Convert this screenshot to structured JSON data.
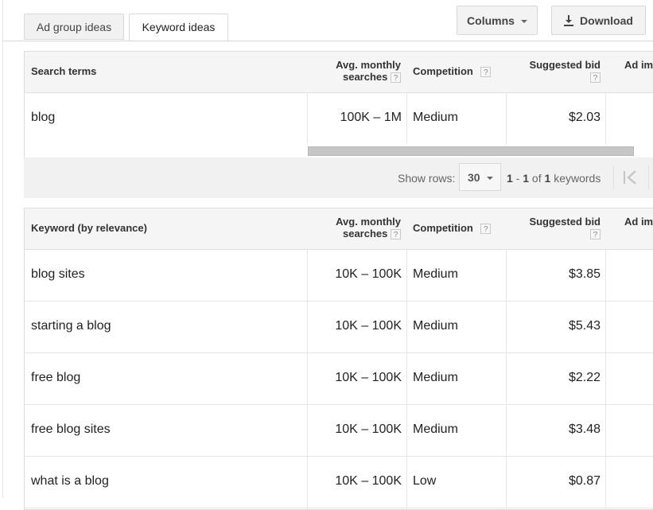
{
  "tabs": [
    {
      "label": "Ad group ideas"
    },
    {
      "label": "Keyword ideas"
    }
  ],
  "toolbar": {
    "columns_label": "Columns",
    "download_label": "Download"
  },
  "table1": {
    "headers": {
      "term": "Search terms",
      "avg_line1": "Avg. monthly",
      "avg_line2": "searches",
      "competition": "Competition",
      "bid": "Suggested bid",
      "adim": "Ad im"
    },
    "rows": [
      {
        "term": "blog",
        "avg": "100K – 1M",
        "competition": "Medium",
        "bid": "$2.03"
      }
    ]
  },
  "pager": {
    "show_rows_label": "Show rows:",
    "rows_value": "30",
    "range_start": "1",
    "range_dash": " - ",
    "range_end": "1",
    "of_text": " of ",
    "total": "1",
    "unit": " keywords"
  },
  "table2": {
    "headers": {
      "term": "Keyword (by relevance)",
      "avg_line1": "Avg. monthly",
      "avg_line2": "searches",
      "competition": "Competition",
      "bid": "Suggested bid",
      "adim": "Ad im"
    },
    "rows": [
      {
        "term": "blog sites",
        "avg": "10K – 100K",
        "competition": "Medium",
        "bid": "$3.85"
      },
      {
        "term": "starting a blog",
        "avg": "10K – 100K",
        "competition": "Medium",
        "bid": "$5.43"
      },
      {
        "term": "free blog",
        "avg": "10K – 100K",
        "competition": "Medium",
        "bid": "$2.22"
      },
      {
        "term": "free blog sites",
        "avg": "10K – 100K",
        "competition": "Medium",
        "bid": "$3.48"
      },
      {
        "term": "what is a blog",
        "avg": "10K – 100K",
        "competition": "Low",
        "bid": "$0.87"
      }
    ]
  },
  "help_mark": "?",
  "icons": {
    "download": "download-arrow-icon",
    "columns_caret": "caret-down-icon",
    "first_page": "first-page-icon"
  }
}
